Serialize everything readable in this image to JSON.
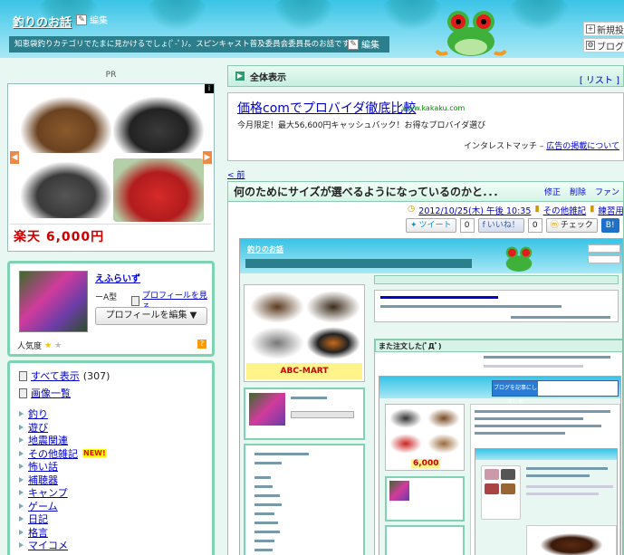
{
  "header": {
    "blog_title": "釣りのお話",
    "edit_label": "編集",
    "description": "知恵袋釣りカテゴリでたまに見かけるでしょ(ﾟ-ﾟ)ﾉ。スピンキャスト普及委員会委員長のお話です",
    "desc_edit_label": "編集",
    "top_links": [
      "新規投",
      "ブログ記"
    ]
  },
  "sidebar": {
    "pr_label": "PR",
    "ad_info": "i",
    "rakuten_text": "楽天 6,000円",
    "profile": {
      "name": "えふらいず",
      "blood_type": "ーA型",
      "view_profile": "プロフィールを見る",
      "edit_profile": "プロフィールを編集",
      "popularity": "人気度",
      "help": "?"
    },
    "all_posts": "すべて表示",
    "all_count": "(307)",
    "image_list": "画像一覧",
    "categories": [
      {
        "label": "釣り",
        "new": false
      },
      {
        "label": "遊び",
        "new": false
      },
      {
        "label": "地震関連",
        "new": false
      },
      {
        "label": "その他雑記",
        "new": true
      },
      {
        "label": "怖い話",
        "new": false
      },
      {
        "label": "補聴器",
        "new": false
      },
      {
        "label": "キャンプ",
        "new": false
      },
      {
        "label": "ゲーム",
        "new": false
      },
      {
        "label": "日記",
        "new": false
      },
      {
        "label": "格言",
        "new": false
      },
      {
        "label": "マイコメ",
        "new": false
      }
    ],
    "new_label": "NEW!"
  },
  "main": {
    "all_label": "全体表示",
    "list_label": "[ リスト ]",
    "text_ad": {
      "title": "価格comでプロバイダ徹底比較",
      "url": "www.kakaku.com",
      "body": "今月限定！最大56,600円キャッシュバック！お得なプロバイダ選び",
      "footer_prefix": "インタレストマッチ – ",
      "footer_link": "広告の掲載について"
    },
    "prev_link": "< 前",
    "entry": {
      "title": "何のためにサイズが選べるようになっているのかと．．．",
      "actions": [
        "修正",
        "削除",
        "ファン"
      ],
      "date": "2012/10/25(木) 午後 10:35",
      "category": "その他雑記",
      "fiction": "練習用",
      "tweet": "ツイート",
      "tweet_count": "0",
      "like": "いいね！",
      "like_count": "0",
      "check": "チェック",
      "bookmark": "B!"
    },
    "nested": {
      "title": "釣りのお話",
      "abc_mart": "ABC-MART",
      "entry_title": "また注文した(ﾟДﾟ)",
      "facebook": "ブログを記事にしました",
      "price": "6,000"
    }
  }
}
